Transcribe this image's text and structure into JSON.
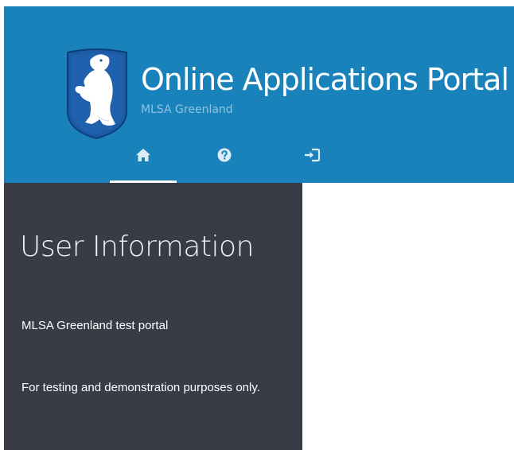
{
  "header": {
    "title": "Online Applications Portal",
    "subtitle": "MLSA Greenland",
    "logo": "greenland-coat-of-arms-polar-bear",
    "background_color": "#1a82bb",
    "subtitle_color": "#8ec3e3"
  },
  "nav": {
    "items": [
      {
        "icon": "home-icon",
        "active": true
      },
      {
        "icon": "help-icon",
        "active": false
      },
      {
        "icon": "login-icon",
        "active": false
      }
    ]
  },
  "sidebar": {
    "heading": "User Information",
    "lines": [
      "MLSA Greenland test portal",
      "For testing and demonstration purposes only."
    ],
    "background_color": "#393c47"
  }
}
